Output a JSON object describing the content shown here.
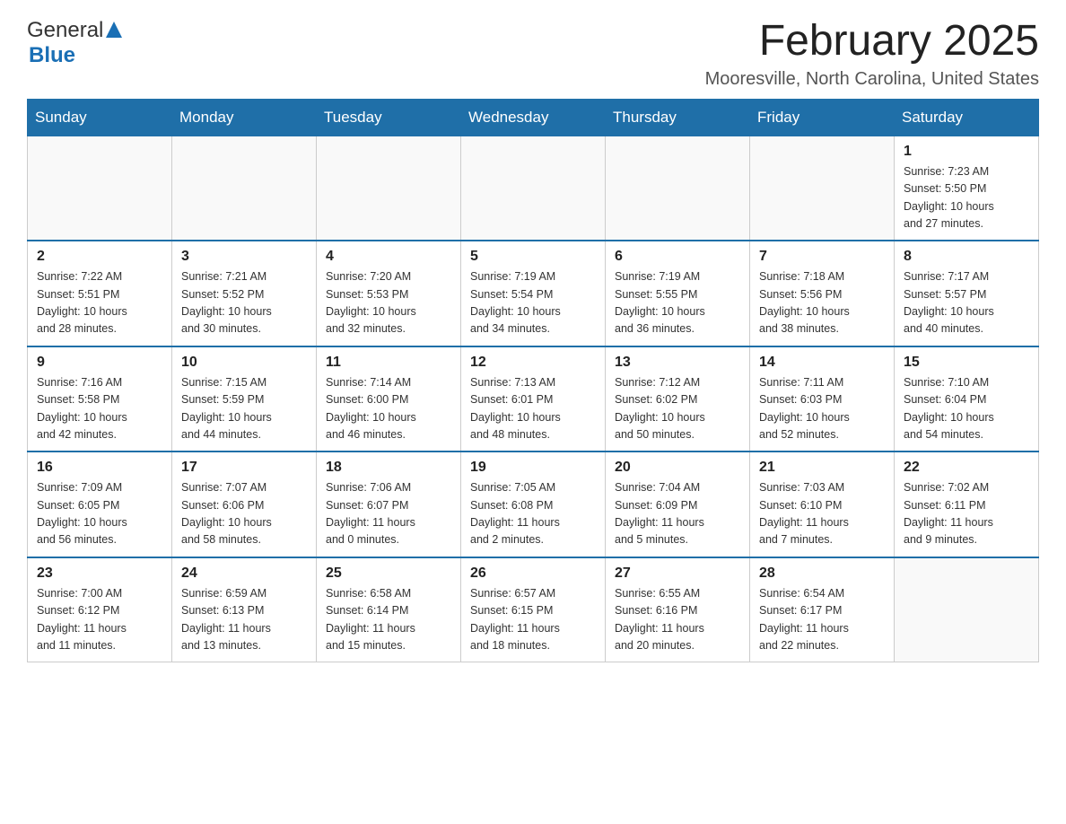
{
  "header": {
    "logo_general": "General",
    "logo_blue": "Blue",
    "title": "February 2025",
    "subtitle": "Mooresville, North Carolina, United States"
  },
  "days_of_week": [
    "Sunday",
    "Monday",
    "Tuesday",
    "Wednesday",
    "Thursday",
    "Friday",
    "Saturday"
  ],
  "weeks": [
    {
      "days": [
        {
          "date": "",
          "info": ""
        },
        {
          "date": "",
          "info": ""
        },
        {
          "date": "",
          "info": ""
        },
        {
          "date": "",
          "info": ""
        },
        {
          "date": "",
          "info": ""
        },
        {
          "date": "",
          "info": ""
        },
        {
          "date": "1",
          "info": "Sunrise: 7:23 AM\nSunset: 5:50 PM\nDaylight: 10 hours\nand 27 minutes."
        }
      ]
    },
    {
      "days": [
        {
          "date": "2",
          "info": "Sunrise: 7:22 AM\nSunset: 5:51 PM\nDaylight: 10 hours\nand 28 minutes."
        },
        {
          "date": "3",
          "info": "Sunrise: 7:21 AM\nSunset: 5:52 PM\nDaylight: 10 hours\nand 30 minutes."
        },
        {
          "date": "4",
          "info": "Sunrise: 7:20 AM\nSunset: 5:53 PM\nDaylight: 10 hours\nand 32 minutes."
        },
        {
          "date": "5",
          "info": "Sunrise: 7:19 AM\nSunset: 5:54 PM\nDaylight: 10 hours\nand 34 minutes."
        },
        {
          "date": "6",
          "info": "Sunrise: 7:19 AM\nSunset: 5:55 PM\nDaylight: 10 hours\nand 36 minutes."
        },
        {
          "date": "7",
          "info": "Sunrise: 7:18 AM\nSunset: 5:56 PM\nDaylight: 10 hours\nand 38 minutes."
        },
        {
          "date": "8",
          "info": "Sunrise: 7:17 AM\nSunset: 5:57 PM\nDaylight: 10 hours\nand 40 minutes."
        }
      ]
    },
    {
      "days": [
        {
          "date": "9",
          "info": "Sunrise: 7:16 AM\nSunset: 5:58 PM\nDaylight: 10 hours\nand 42 minutes."
        },
        {
          "date": "10",
          "info": "Sunrise: 7:15 AM\nSunset: 5:59 PM\nDaylight: 10 hours\nand 44 minutes."
        },
        {
          "date": "11",
          "info": "Sunrise: 7:14 AM\nSunset: 6:00 PM\nDaylight: 10 hours\nand 46 minutes."
        },
        {
          "date": "12",
          "info": "Sunrise: 7:13 AM\nSunset: 6:01 PM\nDaylight: 10 hours\nand 48 minutes."
        },
        {
          "date": "13",
          "info": "Sunrise: 7:12 AM\nSunset: 6:02 PM\nDaylight: 10 hours\nand 50 minutes."
        },
        {
          "date": "14",
          "info": "Sunrise: 7:11 AM\nSunset: 6:03 PM\nDaylight: 10 hours\nand 52 minutes."
        },
        {
          "date": "15",
          "info": "Sunrise: 7:10 AM\nSunset: 6:04 PM\nDaylight: 10 hours\nand 54 minutes."
        }
      ]
    },
    {
      "days": [
        {
          "date": "16",
          "info": "Sunrise: 7:09 AM\nSunset: 6:05 PM\nDaylight: 10 hours\nand 56 minutes."
        },
        {
          "date": "17",
          "info": "Sunrise: 7:07 AM\nSunset: 6:06 PM\nDaylight: 10 hours\nand 58 minutes."
        },
        {
          "date": "18",
          "info": "Sunrise: 7:06 AM\nSunset: 6:07 PM\nDaylight: 11 hours\nand 0 minutes."
        },
        {
          "date": "19",
          "info": "Sunrise: 7:05 AM\nSunset: 6:08 PM\nDaylight: 11 hours\nand 2 minutes."
        },
        {
          "date": "20",
          "info": "Sunrise: 7:04 AM\nSunset: 6:09 PM\nDaylight: 11 hours\nand 5 minutes."
        },
        {
          "date": "21",
          "info": "Sunrise: 7:03 AM\nSunset: 6:10 PM\nDaylight: 11 hours\nand 7 minutes."
        },
        {
          "date": "22",
          "info": "Sunrise: 7:02 AM\nSunset: 6:11 PM\nDaylight: 11 hours\nand 9 minutes."
        }
      ]
    },
    {
      "days": [
        {
          "date": "23",
          "info": "Sunrise: 7:00 AM\nSunset: 6:12 PM\nDaylight: 11 hours\nand 11 minutes."
        },
        {
          "date": "24",
          "info": "Sunrise: 6:59 AM\nSunset: 6:13 PM\nDaylight: 11 hours\nand 13 minutes."
        },
        {
          "date": "25",
          "info": "Sunrise: 6:58 AM\nSunset: 6:14 PM\nDaylight: 11 hours\nand 15 minutes."
        },
        {
          "date": "26",
          "info": "Sunrise: 6:57 AM\nSunset: 6:15 PM\nDaylight: 11 hours\nand 18 minutes."
        },
        {
          "date": "27",
          "info": "Sunrise: 6:55 AM\nSunset: 6:16 PM\nDaylight: 11 hours\nand 20 minutes."
        },
        {
          "date": "28",
          "info": "Sunrise: 6:54 AM\nSunset: 6:17 PM\nDaylight: 11 hours\nand 22 minutes."
        },
        {
          "date": "",
          "info": ""
        }
      ]
    }
  ]
}
